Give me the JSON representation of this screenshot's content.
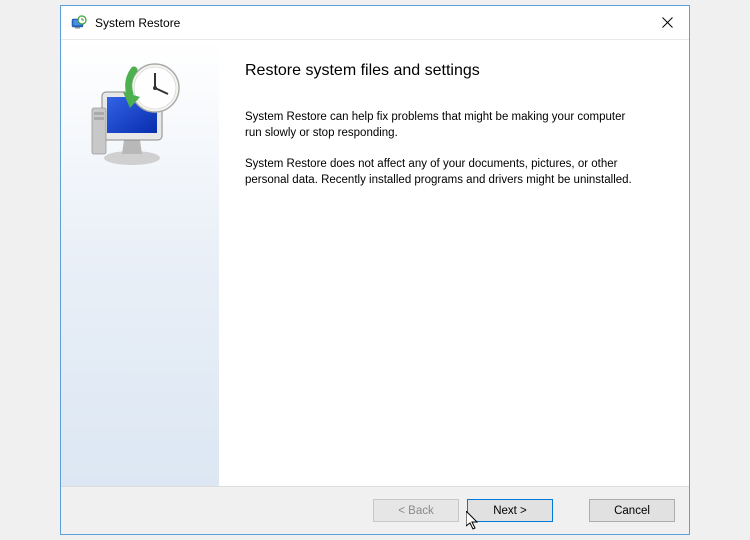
{
  "titlebar": {
    "title": "System Restore"
  },
  "main": {
    "heading": "Restore system files and settings",
    "paragraph1": "System Restore can help fix problems that might be making your computer run slowly or stop responding.",
    "paragraph2": "System Restore does not affect any of your documents, pictures, or other personal data. Recently installed programs and drivers might be uninstalled."
  },
  "footer": {
    "back_label": "< Back",
    "next_label": "Next >",
    "cancel_label": "Cancel"
  }
}
